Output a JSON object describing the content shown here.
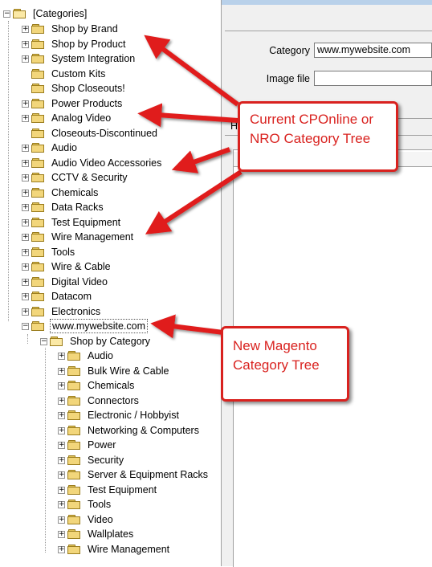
{
  "tree": {
    "root": "[Categories]",
    "top_items": [
      "Shop by Brand",
      "Shop by Product",
      "System Integration",
      "Custom Kits",
      "Shop Closeouts!",
      "Power Products",
      "Analog Video",
      "Closeouts-Discontinued",
      "Audio",
      "Audio Video Accessories",
      "CCTV & Security",
      "Chemicals",
      "Data Racks",
      "Test Equipment",
      "Wire Management",
      "Tools",
      "Wire & Cable",
      "Digital Video",
      "Datacom",
      "Electronics",
      "www.mywebsite.com"
    ],
    "website_child": "Shop by Category",
    "shop_by_category_items": [
      "Audio",
      "Bulk Wire & Cable",
      "Chemicals",
      "Connectors",
      "Electronic / Hobbyist",
      "Networking & Computers",
      "Power",
      "Security",
      "Server & Equipment Racks",
      "Test Equipment",
      "Tools",
      "Video",
      "Wallplates",
      "Wire Management"
    ]
  },
  "form": {
    "category_label": "Category",
    "category_value": "www.mywebsite.com",
    "image_file_label": "Image file",
    "image_file_value": "",
    "tab_partial": "H"
  },
  "callouts": {
    "current_tree": "Current CPOnline or NRO Category Tree",
    "new_tree": "New Magento Category Tree",
    "color": "#d9221f"
  }
}
